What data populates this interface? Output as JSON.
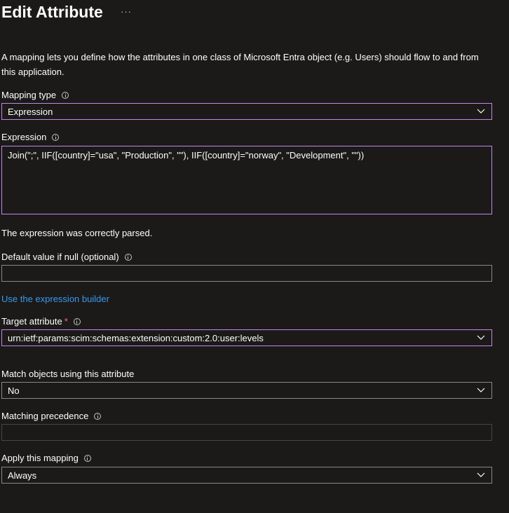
{
  "header": {
    "title": "Edit Attribute",
    "more_label": "···"
  },
  "description": "A mapping lets you define how the attributes in one class of Microsoft Entra object (e.g. Users) should flow to and from this application.",
  "mapping_type": {
    "label": "Mapping type",
    "value": "Expression"
  },
  "expression": {
    "label": "Expression",
    "value": "Join(\";\", IIF([country]=\"usa\", \"Production\", \"\"), IIF([country]=\"norway\", \"Development\", \"\"))",
    "status": "The expression was correctly parsed."
  },
  "default_value": {
    "label": "Default value if null (optional)",
    "value": ""
  },
  "expression_builder_link": "Use the expression builder",
  "target_attribute": {
    "label": "Target attribute",
    "required_marker": "*",
    "value": "urn:ietf:params:scim:schemas:extension:custom:2.0:user:levels"
  },
  "match_objects": {
    "label": "Match objects using this attribute",
    "value": "No"
  },
  "matching_precedence": {
    "label": "Matching precedence",
    "value": ""
  },
  "apply_mapping": {
    "label": "Apply this mapping",
    "value": "Always"
  },
  "colors": {
    "background": "#1b1a19",
    "focus_border": "#c586e6",
    "border": "#8a8886",
    "link": "#3899ec",
    "required": "#f1707b"
  },
  "icons": {
    "info": "info-icon",
    "dropdown": "chevron-down-icon"
  }
}
